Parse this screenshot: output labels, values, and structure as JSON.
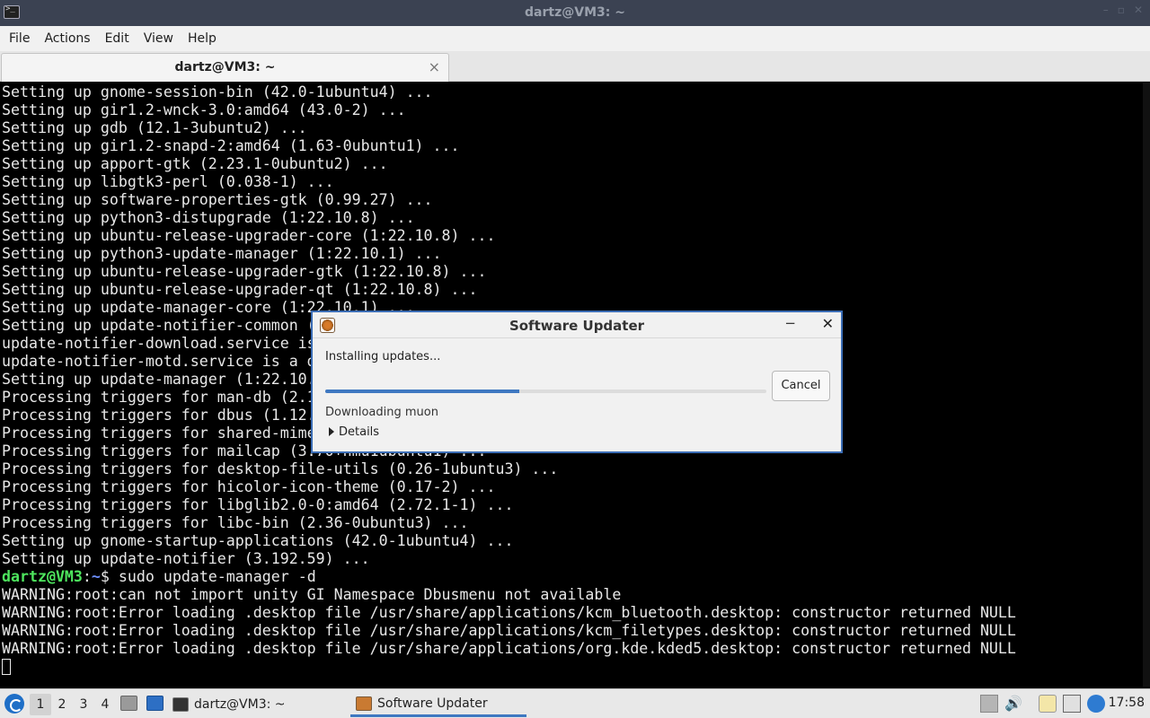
{
  "window": {
    "title": "dartz@VM3: ~"
  },
  "menu": [
    "File",
    "Actions",
    "Edit",
    "View",
    "Help"
  ],
  "tab": {
    "label": "dartz@VM3: ~",
    "close": "×"
  },
  "terminal": {
    "lines": [
      "Setting up gnome-session-bin (42.0-1ubuntu4) ...",
      "Setting up gir1.2-wnck-3.0:amd64 (43.0-2) ...",
      "Setting up gdb (12.1-3ubuntu2) ...",
      "Setting up gir1.2-snapd-2:amd64 (1.63-0ubuntu1) ...",
      "Setting up apport-gtk (2.23.1-0ubuntu2) ...",
      "Setting up libgtk3-perl (0.038-1) ...",
      "Setting up software-properties-gtk (0.99.27) ...",
      "Setting up python3-distupgrade (1:22.10.8) ...",
      "Setting up ubuntu-release-upgrader-core (1:22.10.8) ...",
      "Setting up python3-update-manager (1:22.10.1) ...",
      "Setting up ubuntu-release-upgrader-gtk (1:22.10.8) ...",
      "Setting up ubuntu-release-upgrader-qt (1:22.10.8) ...",
      "Setting up update-manager-core (1:22.10.1) ...",
      "Setting up update-notifier-common (",
      "update-notifier-download.service is",
      "update-notifier-motd.service is a d",
      "Setting up update-manager (1:22.10.",
      "Processing triggers for man-db (2.1",
      "Processing triggers for dbus (1.12.",
      "Processing triggers for shared-mime",
      "Processing triggers for mailcap (3.70+nmu1ubuntu1) ...",
      "Processing triggers for desktop-file-utils (0.26-1ubuntu3) ...",
      "Processing triggers for hicolor-icon-theme (0.17-2) ...",
      "Processing triggers for libglib2.0-0:amd64 (2.72.1-1) ...",
      "Processing triggers for libc-bin (2.36-0ubuntu3) ...",
      "Setting up gnome-startup-applications (42.0-1ubuntu4) ...",
      "Setting up update-notifier (3.192.59) ..."
    ],
    "prompt_user": "dartz@VM3",
    "prompt_sep": ":",
    "prompt_path": "~",
    "prompt_end": "$ ",
    "command": "sudo update-manager -d",
    "output": [
      "WARNING:root:can not import unity GI Namespace Dbusmenu not available",
      "WARNING:root:Error loading .desktop file /usr/share/applications/kcm_bluetooth.desktop: constructor returned NULL",
      "WARNING:root:Error loading .desktop file /usr/share/applications/kcm_filetypes.desktop: constructor returned NULL",
      "WARNING:root:Error loading .desktop file /usr/share/applications/org.kde.kded5.desktop: constructor returned NULL"
    ]
  },
  "dialog": {
    "title": "Software Updater",
    "minimize": "−",
    "close": "✕",
    "status": "Installing updates...",
    "progress_percent": 44,
    "cancel_label": "Cancel",
    "subtask": "Downloading muon",
    "details_label": "Details"
  },
  "taskbar": {
    "desktops": [
      "1",
      "2",
      "3",
      "4"
    ],
    "tasks": [
      {
        "label": "dartz@VM3: ~"
      },
      {
        "label": "Software Updater"
      }
    ],
    "clock": "17:58"
  },
  "colors": {
    "prompt_user": "#4ee65e",
    "prompt_path": "#6d8fff",
    "accent": "#3f78c1"
  }
}
